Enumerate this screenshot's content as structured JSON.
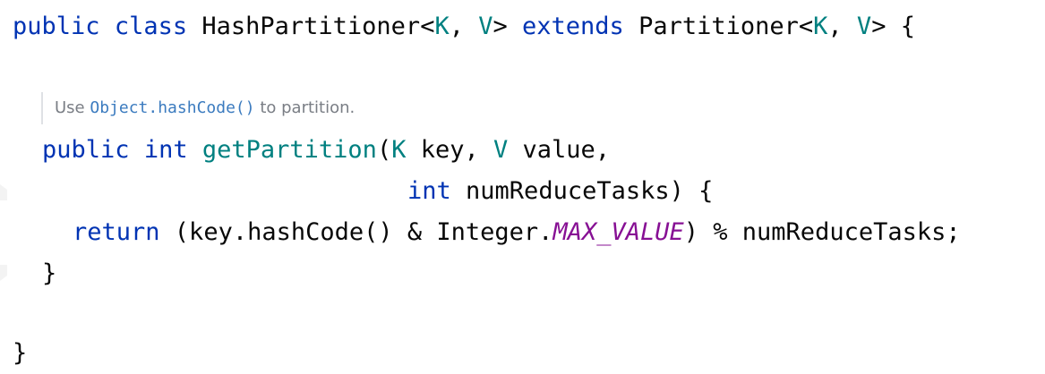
{
  "code": {
    "class_decl": {
      "mod": "public",
      "kw_class": "class",
      "name": "HashPartitioner<",
      "t1": "K",
      "sep1": ", ",
      "t2": "V",
      "gt": "> ",
      "kw_extends": "extends",
      "parent": " Partitioner<",
      "t3": "K",
      "sep2": ", ",
      "t4": "V",
      "end": "> {"
    },
    "doc": {
      "prefix": "Use ",
      "code": "Object.hashCode()",
      "suffix": " to partition."
    },
    "method_decl": {
      "mod": "public",
      "ret": "int",
      "name": "getPartition",
      "open": "(",
      "t1": "K",
      "p1": " key, ",
      "t2": "V",
      "p2": " value,"
    },
    "method_decl_cont": {
      "type": "int",
      "rest": " numReduceTasks) {"
    },
    "return_stmt": {
      "kw": "return",
      "pre": " (key.hashCode() & Integer.",
      "const": "MAX_VALUE",
      "post": ") % numReduceTasks;"
    },
    "method_close": "}",
    "class_close": "}"
  }
}
